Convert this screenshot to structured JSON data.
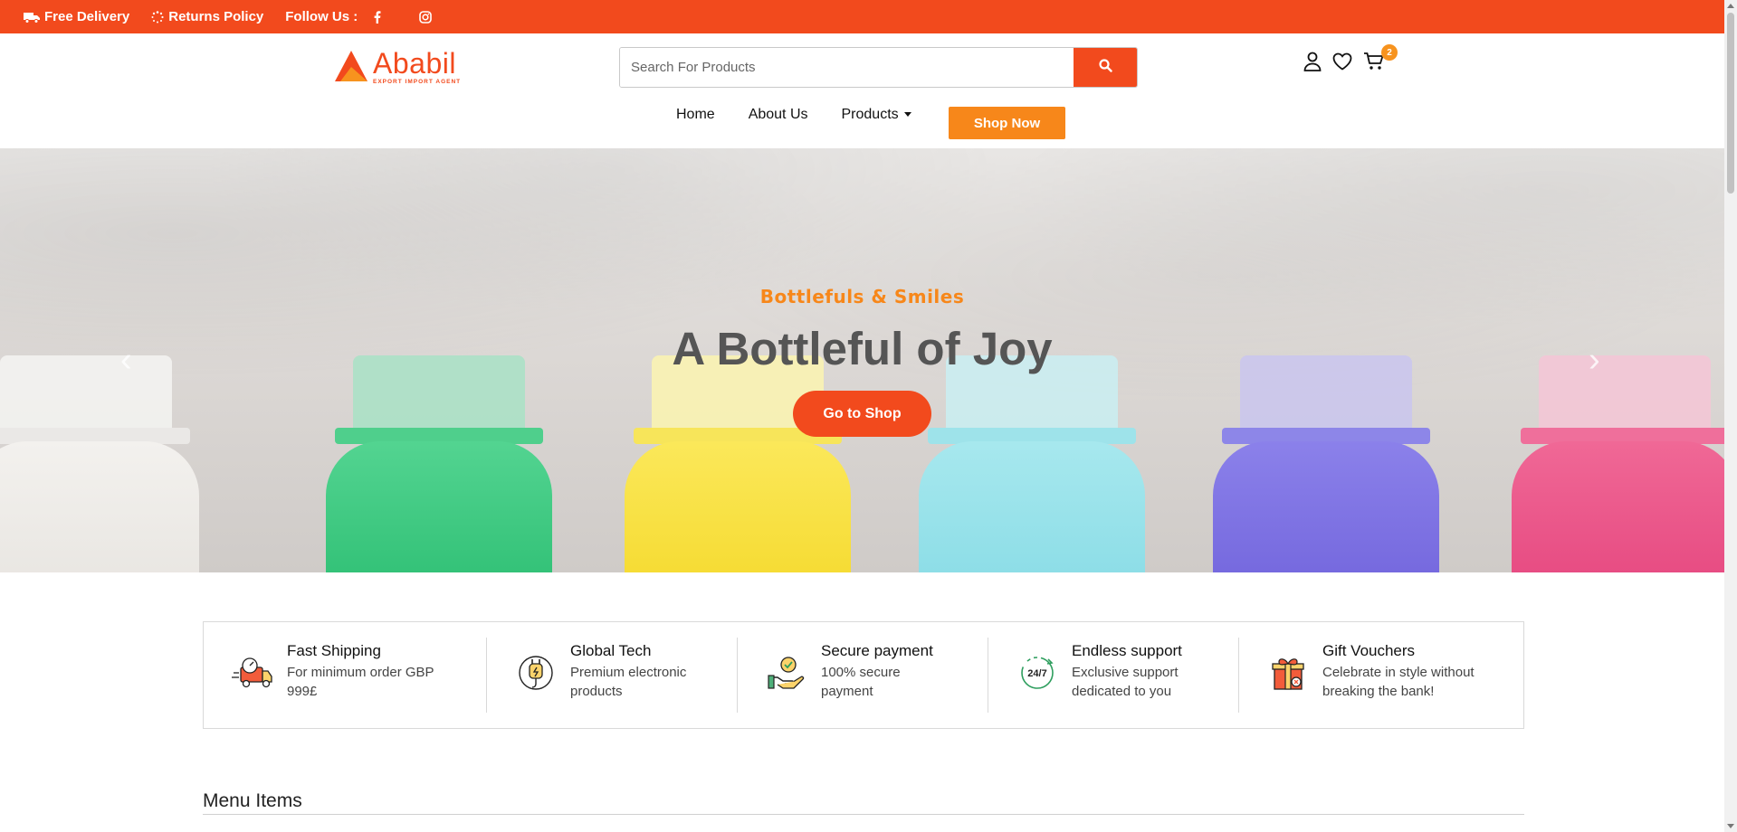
{
  "topbar": {
    "delivery_label": "Free Delivery",
    "returns_label": "Returns Policy",
    "follow_label": "Follow Us :",
    "facebook_icon": "facebook-icon",
    "instagram_icon": "instagram-icon",
    "bg_color": "#f24a1d"
  },
  "header": {
    "logo_name": "Ababil",
    "logo_tagline": "EXPORT IMPORT AGENT",
    "search_placeholder": "Search For Products",
    "cart_count": "2"
  },
  "nav": {
    "items": [
      "Home",
      "About Us",
      "Products"
    ],
    "cta": "Shop Now",
    "cta_color": "#f7871a"
  },
  "hero": {
    "subtitle": "Bottlefuls & Smiles",
    "title": "A Bottleful of Joy",
    "button": "Go to Shop"
  },
  "features": [
    {
      "title": "Fast Shipping",
      "desc": "For minimum order GBP 999£",
      "icon": "shipping-truck-icon"
    },
    {
      "title": "Global Tech",
      "desc": "Premium electronic products",
      "icon": "plug-icon"
    },
    {
      "title": "Secure payment",
      "desc": "100% secure payment",
      "icon": "secure-payment-icon"
    },
    {
      "title": "Endless support",
      "desc": "Exclusive support dedicated to you",
      "icon": "support-24-7-icon"
    },
    {
      "title": "Gift Vouchers",
      "desc": "Celebrate in style without breaking the bank!",
      "icon": "gift-icon"
    }
  ],
  "sections": {
    "menu_heading": "Menu Items"
  }
}
